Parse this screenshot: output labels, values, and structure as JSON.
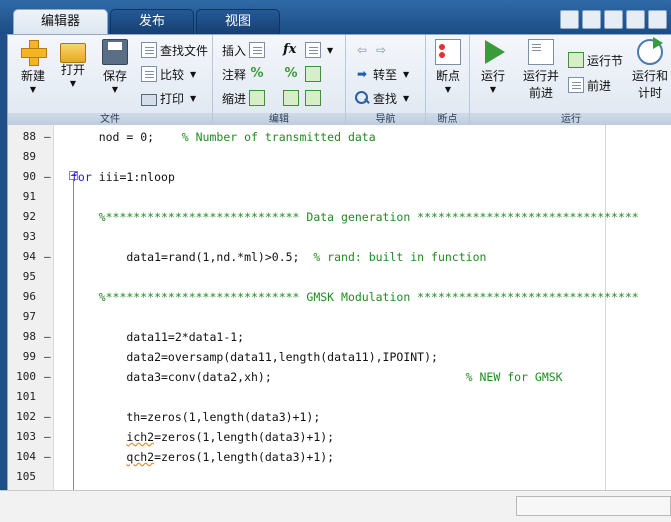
{
  "tabs": [
    {
      "label": "编辑器",
      "active": true
    },
    {
      "label": "发布",
      "active": false
    },
    {
      "label": "视图",
      "active": false
    }
  ],
  "quick_access": [
    "layout-icon",
    "save-icon",
    "cut-icon",
    "copy-icon",
    "paste-icon"
  ],
  "ribbon": {
    "file": {
      "section_label": "文件",
      "new_label": "新建",
      "open_label": "打开",
      "save_label": "保存",
      "find_files_label": "查找文件",
      "compare_label": "比较",
      "print_label": "打印"
    },
    "edit": {
      "section_label": "编辑",
      "insert_label": "插入",
      "comment_label": "注释",
      "indent_label": "缩进",
      "fx_label": "fx",
      "percent_label": "%"
    },
    "navigate": {
      "section_label": "导航",
      "goto_label": "转至",
      "find_label": "查找"
    },
    "breakpoints": {
      "section_label": "断点",
      "breakpoints_label": "断点"
    },
    "run": {
      "section_label": "运行",
      "run_label": "运行",
      "run_advance_label_1": "运行并",
      "run_advance_label_2": "前进",
      "run_section_label": "运行节",
      "advance_label": "前进",
      "run_time_label_1": "运行和",
      "run_time_label_2": "计时"
    }
  },
  "editor": {
    "lines": [
      {
        "num": "88",
        "dash": "–",
        "parts": [
          {
            "t": "    nod = 0;    ",
            "c": ""
          },
          {
            "t": "% Number of transmitted data",
            "c": "cm"
          }
        ]
      },
      {
        "num": "89",
        "dash": "",
        "parts": []
      },
      {
        "num": "90",
        "dash": "–",
        "parts": [
          {
            "t": "for",
            "c": "kw"
          },
          {
            "t": " iii=1:nloop",
            "c": ""
          }
        ]
      },
      {
        "num": "91",
        "dash": "",
        "parts": []
      },
      {
        "num": "92",
        "dash": "",
        "parts": [
          {
            "t": "    %**************************** Data generation ********************************",
            "c": "cm"
          }
        ]
      },
      {
        "num": "93",
        "dash": "",
        "parts": []
      },
      {
        "num": "94",
        "dash": "–",
        "parts": [
          {
            "t": "        data1=rand(1,nd.*ml)>0.5;  ",
            "c": ""
          },
          {
            "t": "% rand: built in function",
            "c": "cm"
          }
        ]
      },
      {
        "num": "95",
        "dash": "",
        "parts": []
      },
      {
        "num": "96",
        "dash": "",
        "parts": [
          {
            "t": "    %**************************** GMSK Modulation ********************************",
            "c": "cm"
          }
        ]
      },
      {
        "num": "97",
        "dash": "",
        "parts": []
      },
      {
        "num": "98",
        "dash": "–",
        "parts": [
          {
            "t": "        data11=2*data1-1;",
            "c": ""
          }
        ]
      },
      {
        "num": "99",
        "dash": "–",
        "parts": [
          {
            "t": "        data2=oversamp(data11,length(data11),IPOINT);",
            "c": ""
          }
        ]
      },
      {
        "num": "100",
        "dash": "–",
        "parts": [
          {
            "t": "        data3=conv(data2,xh);                            ",
            "c": ""
          },
          {
            "t": "% NEW for GMSK",
            "c": "cm"
          }
        ]
      },
      {
        "num": "101",
        "dash": "",
        "parts": []
      },
      {
        "num": "102",
        "dash": "–",
        "parts": [
          {
            "t": "        th=zeros(1,length(data3)+1);",
            "c": ""
          }
        ]
      },
      {
        "num": "103",
        "dash": "–",
        "parts": [
          {
            "t": "        ",
            "c": ""
          },
          {
            "t": "ich2",
            "c": "squig"
          },
          {
            "t": "=zeros(1,length(data3)+1);",
            "c": ""
          }
        ]
      },
      {
        "num": "104",
        "dash": "–",
        "parts": [
          {
            "t": "        ",
            "c": ""
          },
          {
            "t": "qch2",
            "c": "squig"
          },
          {
            "t": "=zeros(1,length(data3)+1);",
            "c": ""
          }
        ]
      },
      {
        "num": "105",
        "dash": "",
        "parts": []
      }
    ]
  }
}
